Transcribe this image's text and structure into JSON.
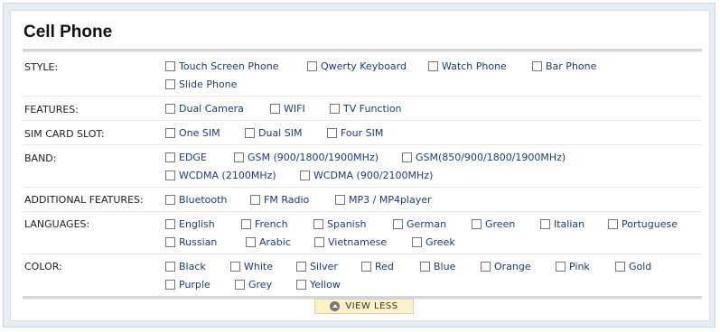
{
  "title": "Cell Phone",
  "rows": [
    {
      "key": "style",
      "label": "STYLE:",
      "options": [
        "Touch Screen Phone",
        "Qwerty Keyboard",
        "Watch Phone",
        "Bar Phone",
        "Slide Phone"
      ]
    },
    {
      "key": "features",
      "label": "FEATURES:",
      "options": [
        "Dual Camera",
        "WIFI",
        "TV Function"
      ]
    },
    {
      "key": "sim",
      "label": "SIM CARD SLOT:",
      "options": [
        "One SIM",
        "Dual SIM",
        "Four SIM"
      ]
    },
    {
      "key": "band",
      "label": "BAND:",
      "options": [
        "EDGE",
        "GSM (900/1800/1900MHz)",
        "GSM(850/900/1800/1900MHz)",
        "WCDMA (2100MHz)",
        "WCDMA (900/2100MHz)"
      ]
    },
    {
      "key": "additional",
      "label": "ADDITIONAL FEATURES:",
      "options": [
        "Bluetooth",
        "FM Radio",
        "MP3 / MP4player"
      ]
    },
    {
      "key": "languages",
      "label": "LANGUAGES:",
      "options": [
        "English",
        "French",
        "Spanish",
        "German",
        "Green",
        "Italian",
        "Portuguese",
        "Russian",
        "Arabic",
        "Vietnamese",
        "Greek"
      ]
    },
    {
      "key": "color",
      "label": "COLOR:",
      "options": [
        "Black",
        "White",
        "Silver",
        "Red",
        "Blue",
        "Orange",
        "Pink",
        "Gold",
        "Purple",
        "Grey",
        "Yellow"
      ]
    }
  ],
  "view_less_label": "VIEW LESS"
}
